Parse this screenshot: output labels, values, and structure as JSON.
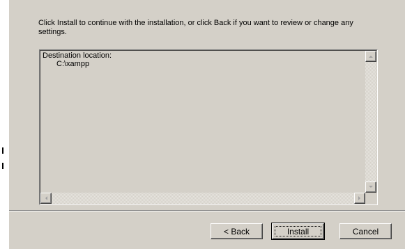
{
  "wizard": {
    "instruction": "Click Install to continue with the installation, or click Back if you want to review or change any settings.",
    "summary": {
      "destination_label": "Destination location:",
      "destination_value": "C:\\xampp"
    },
    "buttons": {
      "back": "< Back",
      "install": "Install",
      "cancel": "Cancel"
    }
  },
  "icons": {
    "scroll_up": "arrow-up-icon",
    "scroll_down": "arrow-down-icon",
    "scroll_left": "arrow-left-icon",
    "scroll_right": "arrow-right-icon"
  },
  "colors": {
    "dialog_bg": "#d4d0c8",
    "shadow": "#808080",
    "highlight": "#ffffff"
  }
}
